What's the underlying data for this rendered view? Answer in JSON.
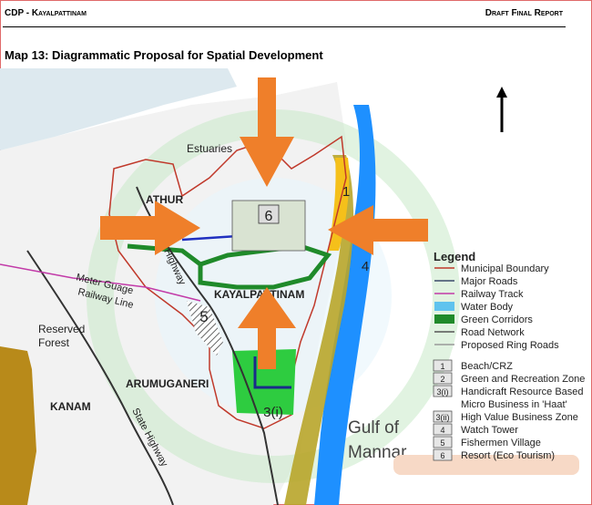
{
  "header": {
    "left": "CDP - Kayalpattinam",
    "right": "Draft Final Report"
  },
  "title": "Map 13: Diagrammatic Proposal for Spatial Development",
  "map_labels": {
    "estuaries": "Estuaries",
    "athur": "ATHUR",
    "highway": "Highway",
    "meter_gauge": "Meter Guage",
    "railway_line": "Railway Line",
    "kayalpattinam": "KAYALPATTINAM",
    "reserved": "Reserved",
    "forest": "Forest",
    "arumuganeri": "ARUMUGANERI",
    "kanam": "KANAM",
    "state_highway": "State Highway",
    "gulf_of": "Gulf of",
    "mannar": "Mannar"
  },
  "zone_numbers": {
    "z1": "1",
    "z4": "4",
    "z5": "5",
    "z6": "6",
    "z3i": "3(i)"
  },
  "legend": {
    "title": "Legend",
    "items": [
      {
        "key": "municipal_boundary",
        "label": "Municipal Boundary",
        "symbol": "line",
        "color": "#c0392b"
      },
      {
        "key": "major_roads",
        "label": "Major Roads",
        "symbol": "line",
        "color": "#3a4a6b"
      },
      {
        "key": "railway_track",
        "label": "Railway Track",
        "symbol": "line",
        "color": "#c23aa8"
      },
      {
        "key": "water_body",
        "label": "Water Body",
        "symbol": "box",
        "color": "#5fc3ee"
      },
      {
        "key": "green_corridors",
        "label": "Green Corridors",
        "symbol": "box",
        "color": "#1f8a2a"
      },
      {
        "key": "road_network",
        "label": "Road Network",
        "symbol": "line",
        "color": "#555555"
      },
      {
        "key": "proposed_ring_roads",
        "label": "Proposed Ring Roads",
        "symbol": "line",
        "color": "#999999"
      }
    ],
    "zones": [
      {
        "num": "1",
        "label": "Beach/CRZ"
      },
      {
        "num": "2",
        "label": "Green and Recreation Zone"
      },
      {
        "num": "3(i)",
        "label": "Handicraft Resource Based"
      },
      {
        "num": "",
        "label": "Micro Business in 'Haat'"
      },
      {
        "num": "3(ii)",
        "label": "High Value Business Zone"
      },
      {
        "num": "4",
        "label": "Watch Tower"
      },
      {
        "num": "5",
        "label": "Fishermen Village"
      },
      {
        "num": "6",
        "label": "Resort (Eco Tourism)"
      }
    ]
  },
  "north_arrow": "north-arrow-icon",
  "colors": {
    "arrow": "#ef7f2a",
    "beach": "#c9a227",
    "sea": "#1e90ff",
    "green": "#2ecc40",
    "boundary": "#c0392b",
    "highlight": "#f7d9c6"
  }
}
